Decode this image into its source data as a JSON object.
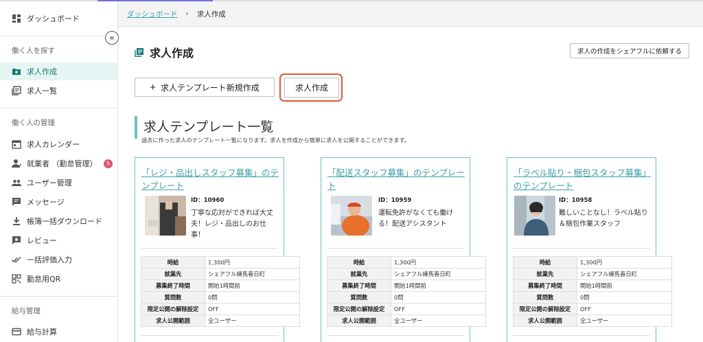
{
  "breadcrumb": {
    "parent": "ダッシュボード",
    "separator": "›",
    "current": "求人作成"
  },
  "sidebar": {
    "dashboard": "ダッシュボード",
    "collapse_label": "«",
    "sections": [
      {
        "heading": "働く人を探す",
        "items": [
          {
            "label": "求人作成",
            "icon": "star-folder-icon",
            "active": true
          },
          {
            "label": "求人一覧",
            "icon": "list-icon",
            "active": false
          }
        ]
      },
      {
        "heading": "働く人の管理",
        "items": [
          {
            "label": "求人カレンダー",
            "icon": "calendar-icon"
          },
          {
            "label": "就業者 （勤怠管理）",
            "icon": "worker-icon",
            "badge": "5"
          },
          {
            "label": "ユーザー管理",
            "icon": "users-icon"
          },
          {
            "label": "メッセージ",
            "icon": "message-icon"
          },
          {
            "label": "帳簿一括ダウンロード",
            "icon": "download-icon"
          },
          {
            "label": "レビュー",
            "icon": "review-icon"
          },
          {
            "label": "一括評価入力",
            "icon": "double-check-icon"
          },
          {
            "label": "勤怠用QR",
            "icon": "qr-icon"
          }
        ]
      },
      {
        "heading": "給与管理",
        "items": [
          {
            "label": "給与計算",
            "icon": "card-icon"
          }
        ]
      }
    ]
  },
  "page": {
    "title": "求人作成",
    "ask_button": "求人の作成をシェアフルに依頼する",
    "new_template_button": "求人テンプレート新規作成",
    "new_template_plus": "+",
    "create_button": "求人作成"
  },
  "templates": {
    "title": "求人テンプレート一覧",
    "description": "過去に作った求人のテンプレート一覧になります。求人を作成から簡単に求人を公開することができます。",
    "cards": [
      {
        "title": "「レジ・品出しスタッフ募集」のテンプレート",
        "id_text": "ID：10960",
        "copy": "丁寧な応対ができれば大丈夫！レジ・品出しのお仕事！",
        "rows": [
          {
            "k": "時給",
            "v": "1,300円"
          },
          {
            "k": "就業先",
            "v": "シェアフル練馬春日町"
          },
          {
            "k": "募集終了時間",
            "v": "開始1時間前"
          },
          {
            "k": "質問数",
            "v": "0問"
          },
          {
            "k": "限定公開の解除設定",
            "v": "OFF"
          },
          {
            "k": "求人公開範囲",
            "v": "全ユーザー"
          }
        ]
      },
      {
        "title": "「配送スタッフ募集」のテンプレート",
        "id_text": "ID：10959",
        "copy": "運転免許がなくても働ける！配送アシスタント",
        "rows": [
          {
            "k": "時給",
            "v": "1,300円"
          },
          {
            "k": "就業先",
            "v": "シェアフル練馬春日町"
          },
          {
            "k": "募集終了時間",
            "v": "開始1時間前"
          },
          {
            "k": "質問数",
            "v": "0問"
          },
          {
            "k": "限定公開の解除設定",
            "v": "OFF"
          },
          {
            "k": "求人公開範囲",
            "v": "全ユーザー"
          }
        ]
      },
      {
        "title": "「ラベル貼り・梱包スタッフ募集」のテンプレート",
        "id_text": "ID：10958",
        "copy": "難しいことなし！ラベル貼り＆梱包作業スタッフ",
        "rows": [
          {
            "k": "時給",
            "v": "1,300円"
          },
          {
            "k": "就業先",
            "v": "シェアフル練馬春日町"
          },
          {
            "k": "募集終了時間",
            "v": "開始1時間前"
          },
          {
            "k": "質問数",
            "v": "0問"
          },
          {
            "k": "限定公開の解除設定",
            "v": "OFF"
          },
          {
            "k": "求人公開範囲",
            "v": "全ユーザー"
          }
        ]
      }
    ]
  }
}
